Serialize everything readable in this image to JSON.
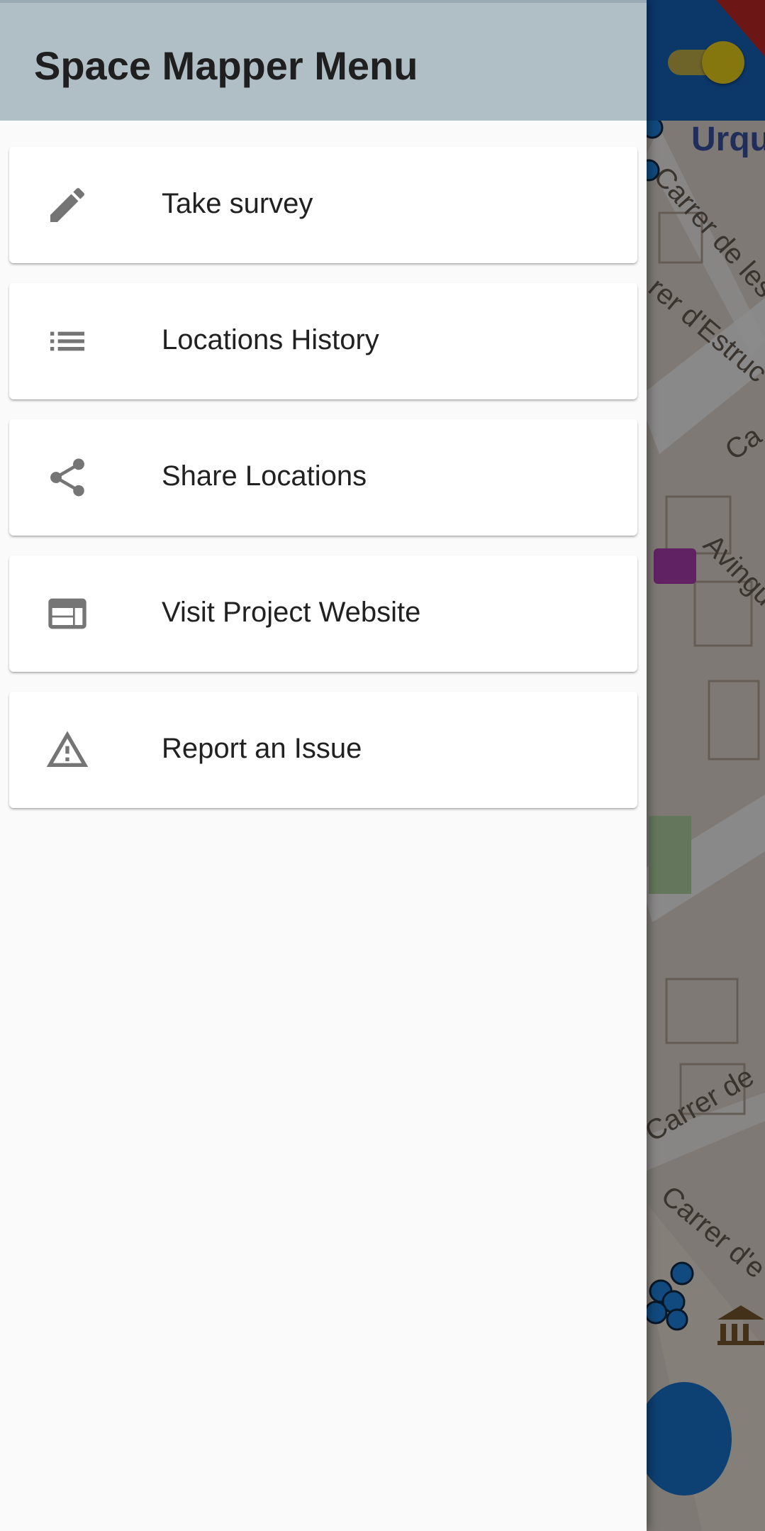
{
  "drawer": {
    "title": "Space Mapper Menu",
    "items": [
      {
        "label": "Take survey",
        "icon": "pencil-icon"
      },
      {
        "label": "Locations History",
        "icon": "list-icon"
      },
      {
        "label": "Share Locations",
        "icon": "share-icon"
      },
      {
        "label": "Visit Project Website",
        "icon": "web-icon"
      },
      {
        "label": "Report an Issue",
        "icon": "warning-icon"
      }
    ]
  },
  "map": {
    "street_labels": [
      "Urqu",
      "Carrer de les",
      "rer d'Estruc",
      "Ca",
      "Avingu",
      "Carrer de",
      "Carrer d'e"
    ]
  },
  "colors": {
    "drawer_header": "#b0bec5",
    "app_bar": "#1565c0",
    "toggle_thumb": "#f2d81a",
    "fab": "#1976d2",
    "icon_gray": "#757575"
  }
}
